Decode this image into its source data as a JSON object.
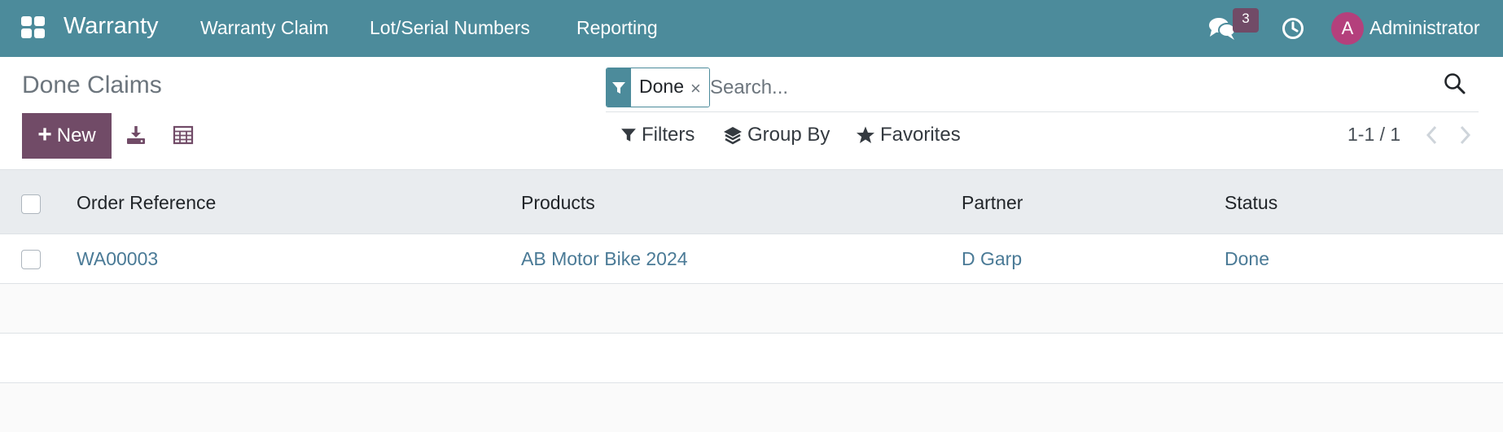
{
  "navbar": {
    "app_title": "Warranty",
    "menu": [
      "Warranty Claim",
      "Lot/Serial Numbers",
      "Reporting"
    ],
    "message_count": "3",
    "avatar_initial": "A",
    "user_name": "Administrator",
    "bg_color": "#4c8b9b"
  },
  "control_panel": {
    "title": "Done Claims",
    "new_label": "New",
    "search": {
      "facet_value": "Done",
      "facet_remove": "×",
      "placeholder": "Search..."
    },
    "filters_label": "Filters",
    "group_by_label": "Group By",
    "favorites_label": "Favorites",
    "pager_value": "1-1 / 1"
  },
  "table": {
    "headers": [
      "Order Reference",
      "Products",
      "Partner",
      "Status"
    ],
    "rows": [
      [
        "WA00003",
        "AB Motor Bike 2024",
        "D Garp",
        "Done"
      ]
    ]
  },
  "icons": {
    "apps": "apps-grid-icon",
    "chat": "chat-icon",
    "clock": "activity-clock-icon",
    "download": "download-icon",
    "table": "spreadsheet-icon",
    "search": "search-icon",
    "filter": "filter-icon",
    "group_by": "layers-icon",
    "favorites": "star-icon"
  },
  "colors": {
    "primary": "#714b67",
    "link": "#4a7a96",
    "navbar": "#4c8b9b"
  }
}
